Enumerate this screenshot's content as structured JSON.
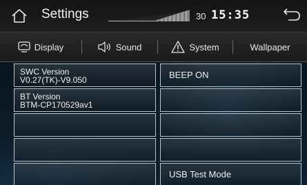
{
  "header": {
    "title": "Settings",
    "volume_level": "30",
    "clock": "15:35"
  },
  "tabs": [
    {
      "label": "Display",
      "icon": "display-icon"
    },
    {
      "label": "Sound",
      "icon": "speaker-icon"
    },
    {
      "label": "System",
      "icon": "warning-icon"
    },
    {
      "label": "Wallpaper",
      "icon": ""
    }
  ],
  "left_column": [
    {
      "title": "SWC Version",
      "value": "V0.27(TK)-V9.050"
    },
    {
      "title": "BT Version",
      "value": "BTM-CP170529av1"
    },
    {
      "title": "",
      "value": ""
    },
    {
      "title": "",
      "value": ""
    },
    {
      "title": "",
      "value": ""
    }
  ],
  "right_column": [
    {
      "label": "BEEP ON"
    },
    {
      "label": ""
    },
    {
      "label": ""
    },
    {
      "label": ""
    },
    {
      "label": "USB Test Mode"
    }
  ],
  "colors": {
    "header_bg": "#1a1a1a",
    "text": "#f0f0f0",
    "cell_border": "#b9c3c9"
  }
}
